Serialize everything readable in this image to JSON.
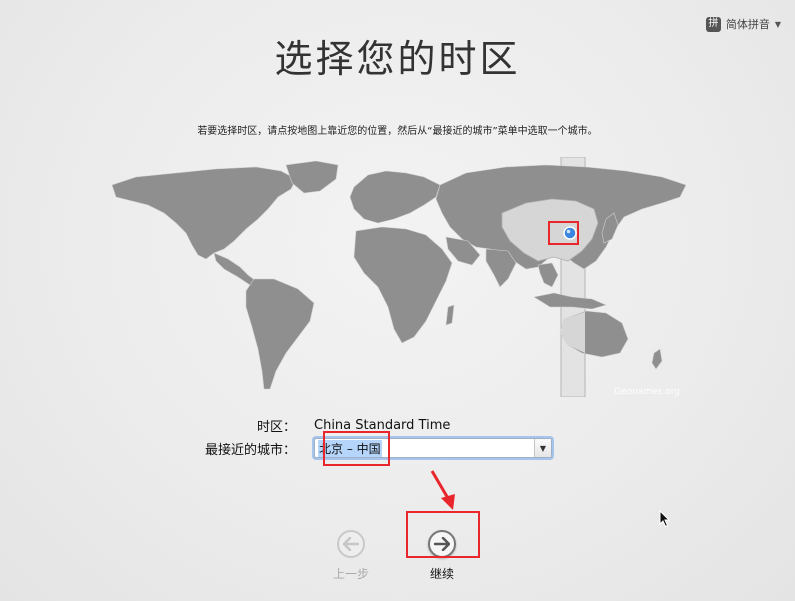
{
  "input_menu": {
    "icon_glyph": "拼",
    "label": "简体拼音",
    "caret": "▼"
  },
  "title": "选择您的时区",
  "instructions": "若要选择时区，请点按地图上靠近您的位置，然后从“最接近的城市”菜单中选取一个城市。",
  "map": {
    "credit": "Geonames.org",
    "land_color": "#8f8f8f",
    "highlight_color": "#d6d6d6",
    "pin_color": "#3a86e0"
  },
  "form": {
    "timezone_label": "时区：",
    "timezone_value": "China Standard Time",
    "city_label": "最接近的城市：",
    "city_value": "北京 – 中国"
  },
  "nav": {
    "back_label": "上一步",
    "back_icon": "arrow-left-icon",
    "next_label": "继续",
    "next_icon": "arrow-right-icon"
  },
  "colors": {
    "annotation": "#e8262b",
    "selection": "#b5d5fb"
  }
}
